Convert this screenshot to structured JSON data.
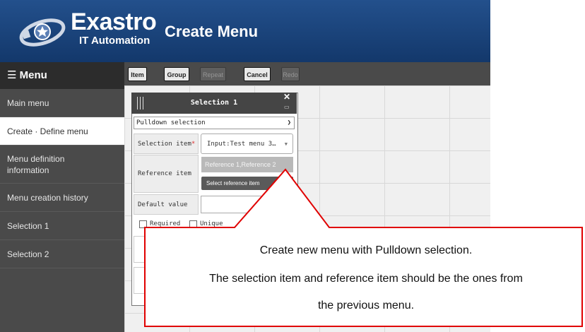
{
  "header": {
    "brand": "Exastro",
    "brand_sub": "IT Automation",
    "page_title": "Create Menu",
    "colors": {
      "header_bg": "#1b457b",
      "sidebar_bg": "#4a4a4a",
      "callout_border": "#e00000"
    }
  },
  "sidebar": {
    "menu_icon": "hamburger-icon",
    "title": "Menu",
    "items": [
      {
        "label": "Main menu"
      },
      {
        "label": "Create · Define menu",
        "active": true
      },
      {
        "label": "Menu definition information"
      },
      {
        "label": "Menu creation history"
      },
      {
        "label": "Selection 1"
      },
      {
        "label": "Selection 2"
      }
    ]
  },
  "toolbar": {
    "item": "Item",
    "group": "Group",
    "repeat": "Repeat",
    "cancel": "Cancel",
    "redo": "Redo"
  },
  "panel": {
    "title": "Selection 1",
    "close_icon": "close-icon",
    "type_value": "Pulldown selection",
    "selection_item_label": "Selection item",
    "required_mark": "*",
    "selection_item_value": "Input:Test menu 3…",
    "reference_item_label": "Reference item",
    "reference_item_value": "Reference 1,Reference 2",
    "select_reference_button": "Select reference item",
    "default_value_label": "Default value",
    "required_checkbox": "Required",
    "unique_checkbox": "Unique"
  },
  "callout": {
    "line1": "Create new menu with Pulldown selection.",
    "line2": "The selection item and reference item should be the ones from",
    "line3": "the previous menu."
  }
}
